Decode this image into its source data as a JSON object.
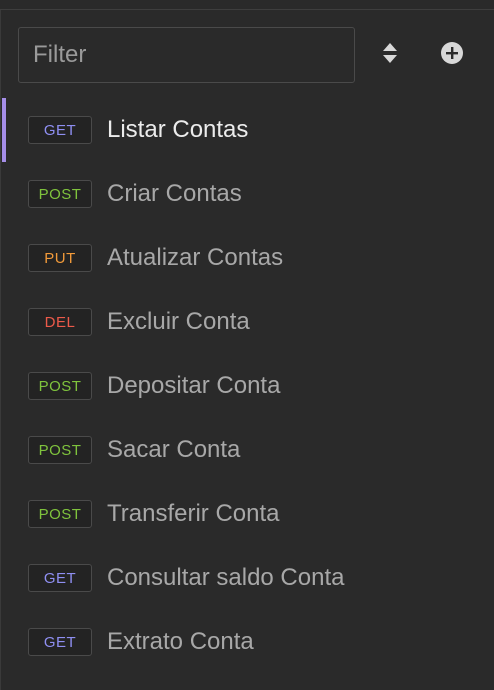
{
  "filter": {
    "placeholder": "Filter",
    "value": ""
  },
  "icons": {
    "sort": "sort-icon",
    "add": "add-circle-icon"
  },
  "colors": {
    "GET": "#8f8ff2",
    "POST": "#7fc33d",
    "PUT": "#f19a3a",
    "DEL": "#ec5a4a",
    "accent": "#a58ee8"
  },
  "requests": [
    {
      "method": "GET",
      "name": "Listar Contas",
      "active": true
    },
    {
      "method": "POST",
      "name": "Criar Contas",
      "active": false
    },
    {
      "method": "PUT",
      "name": "Atualizar Contas",
      "active": false
    },
    {
      "method": "DEL",
      "name": "Excluir Conta",
      "active": false
    },
    {
      "method": "POST",
      "name": "Depositar Conta",
      "active": false
    },
    {
      "method": "POST",
      "name": "Sacar Conta",
      "active": false
    },
    {
      "method": "POST",
      "name": "Transferir Conta",
      "active": false
    },
    {
      "method": "GET",
      "name": "Consultar saldo Conta",
      "active": false
    },
    {
      "method": "GET",
      "name": "Extrato Conta",
      "active": false
    }
  ]
}
